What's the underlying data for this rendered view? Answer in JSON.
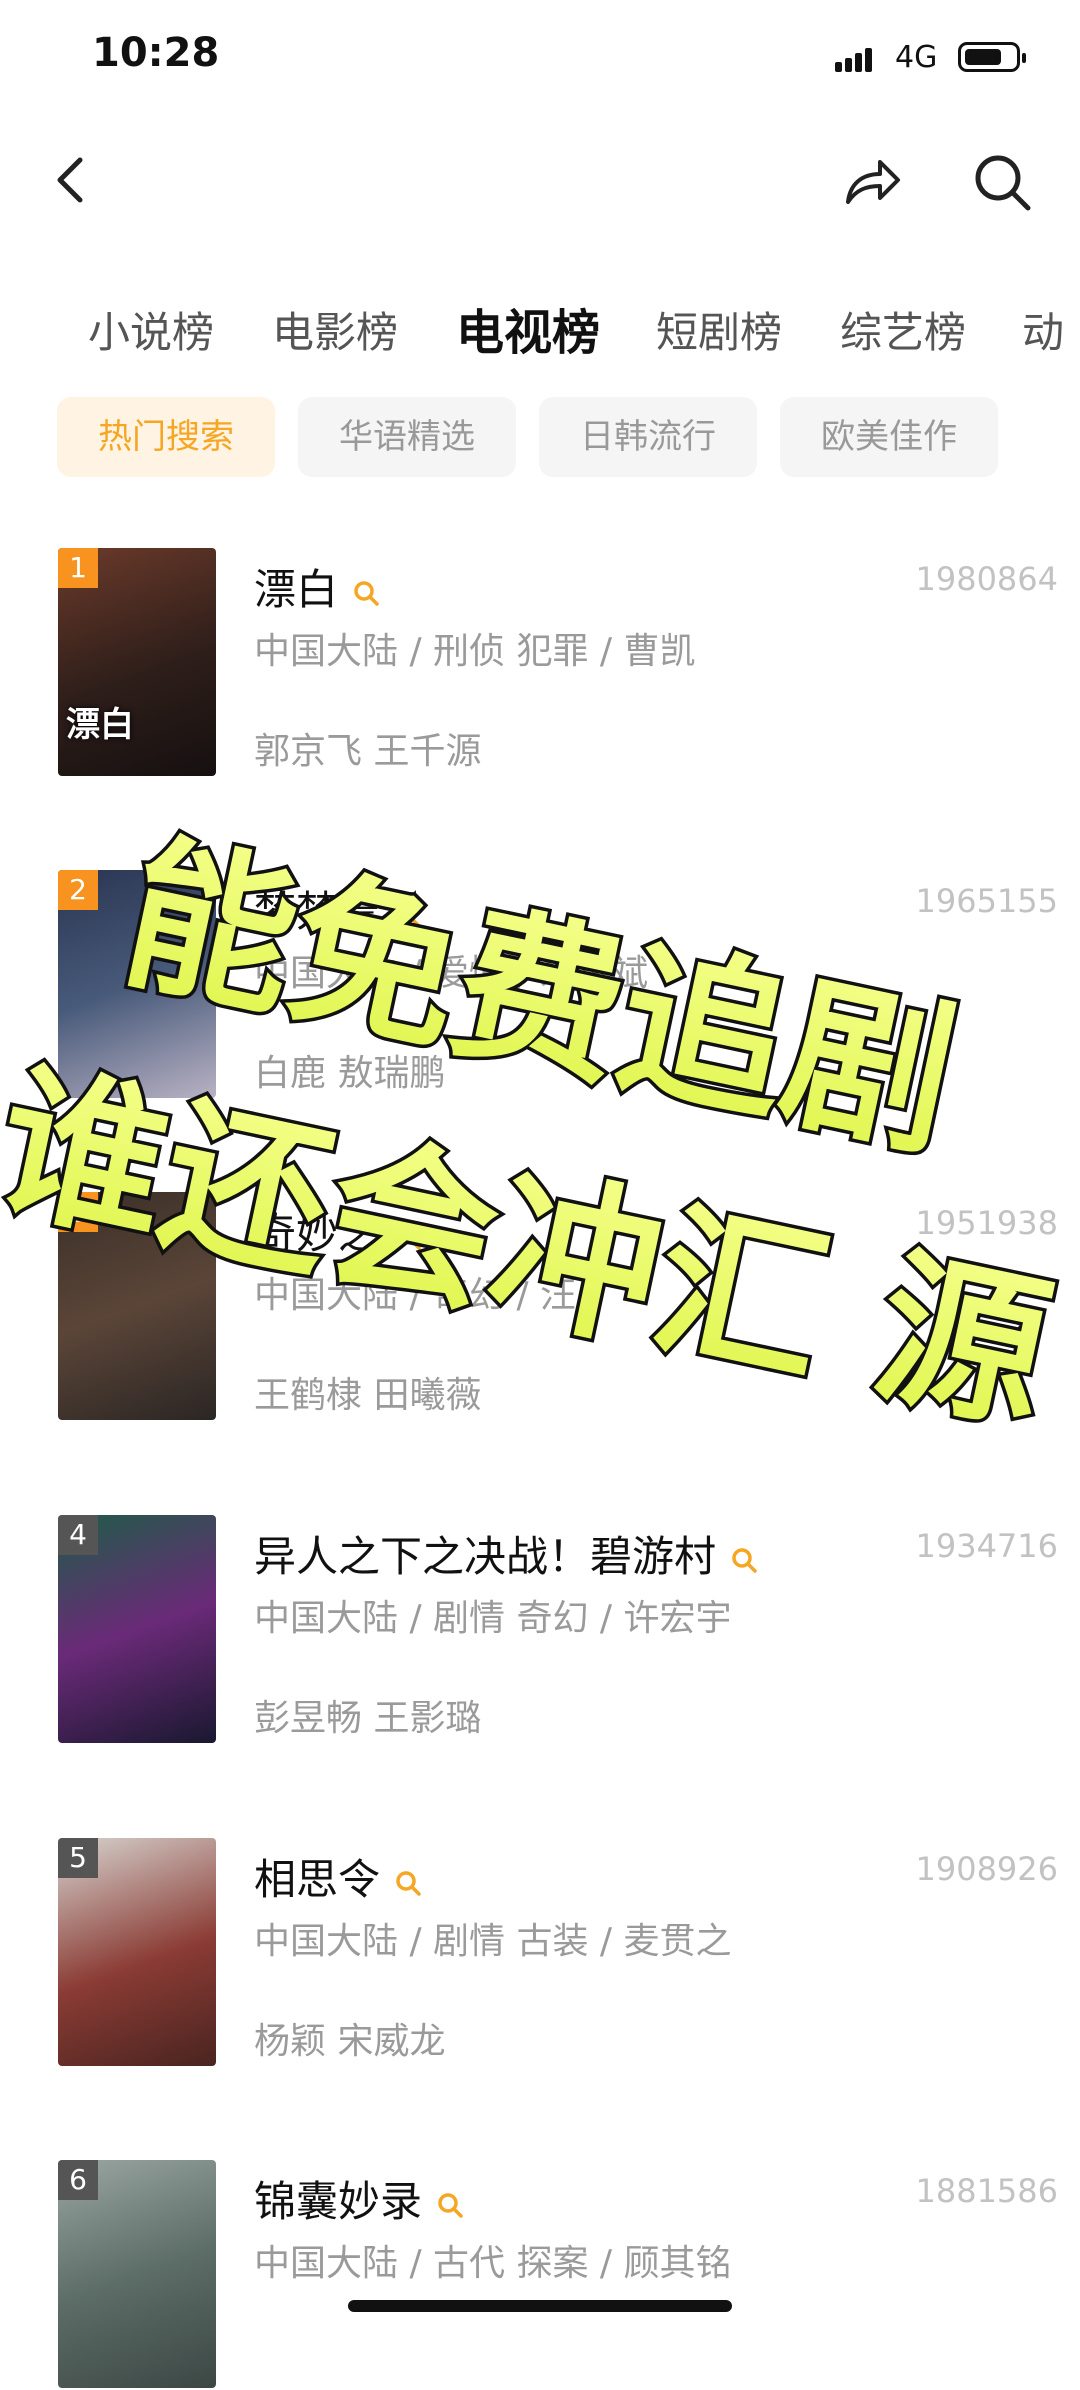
{
  "status_bar": {
    "time": "10:28",
    "network": "4G"
  },
  "category_tabs": [
    "小说榜",
    "电影榜",
    "电视榜",
    "短剧榜",
    "综艺榜",
    "动"
  ],
  "active_tab_index": 2,
  "filter_chips": [
    "热门搜索",
    "华语精选",
    "日韩流行",
    "欧美佳作"
  ],
  "active_chip_index": 0,
  "colors": {
    "accent": "#f5a623",
    "chip_active_bg": "#fff3e3",
    "overlay_fill": "#e8f96a"
  },
  "items": [
    {
      "rank": "1",
      "poster_text": "漂白",
      "title": "漂白",
      "count": "1980864",
      "meta": "中国大陆 / 刑侦 犯罪 / 曹凯",
      "cast": "郭京飞 王千源"
    },
    {
      "rank": "2",
      "poster_text": "",
      "title": "梦梵晨",
      "count": "1965155",
      "meta": "中国大陆 / 爱情 / 朱锐斌",
      "cast": "白鹿 敖瑞鹏"
    },
    {
      "rank": "3",
      "poster_text": "",
      "title": "奇妙之",
      "count": "1951938",
      "meta": "中国大陆 / 奇幻 / 汪",
      "cast": "王鹤棣 田曦薇"
    },
    {
      "rank": "4",
      "poster_text": "",
      "title": "异人之下之决战！碧游村",
      "count": "1934716",
      "meta": "中国大陆 / 剧情 奇幻 / 许宏宇",
      "cast": "彭昱畅 王影璐"
    },
    {
      "rank": "5",
      "poster_text": "",
      "title": "相思令",
      "count": "1908926",
      "meta": "中国大陆 / 剧情 古装 / 麦贯之",
      "cast": "杨颖 宋威龙"
    },
    {
      "rank": "6",
      "poster_text": "",
      "title": "锦囊妙录",
      "count": "1881586",
      "meta": "中国大陆 / 古代 探案 / 顾其铭",
      "cast": ""
    }
  ],
  "overlay_text": {
    "line1": "能免费追剧",
    "line2": "谁还会冲汇 源"
  }
}
